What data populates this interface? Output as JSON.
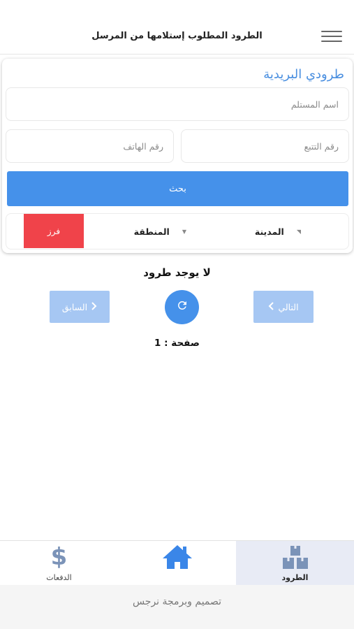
{
  "header": {
    "title": "الطرود المطلوب إستلامها من المرسل",
    "menu_icon": "hamburger-menu-icon"
  },
  "search_card": {
    "title": "طرودي البريدية",
    "recipient_name": {
      "placeholder": "اسم المستلم",
      "value": ""
    },
    "tracking_number": {
      "placeholder": "رقم التتبع",
      "value": ""
    },
    "phone_number": {
      "placeholder": "رقم الهاتف",
      "value": ""
    },
    "search_label": "بحث",
    "city_label": "المدينة",
    "area_label": "المنطقة",
    "sort_label": "فرز"
  },
  "results": {
    "empty_message": "لا يوجد طرود",
    "next_label": "التالي",
    "prev_label": "السابق",
    "page_label": "صفحة : 1"
  },
  "bottom_nav": {
    "items": [
      {
        "label": "الطرود",
        "icon": "boxes-icon",
        "active": true
      },
      {
        "label": "",
        "icon": "home-icon",
        "active": false
      },
      {
        "label": "الدفعات",
        "icon": "dollar-icon",
        "active": false
      }
    ]
  },
  "footer": {
    "text": "تصميم وبرمجة نرجس"
  },
  "colors": {
    "accent": "#4591ea",
    "title_blue": "#4a8fe0",
    "sort_red": "#f0434a",
    "pager_light_blue": "#a6c7f3",
    "nav_icon": "#7b93b8",
    "home_icon": "#3a86e8"
  }
}
